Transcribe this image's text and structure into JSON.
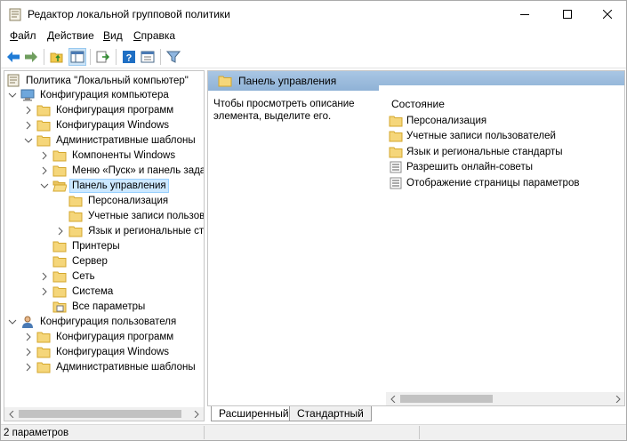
{
  "window": {
    "title": "Редактор локальной групповой политики"
  },
  "menu": [
    {
      "pre": "",
      "key": "Ф",
      "post": "айл"
    },
    {
      "pre": "",
      "key": "Д",
      "post": "ействие"
    },
    {
      "pre": "",
      "key": "В",
      "post": "ид"
    },
    {
      "pre": "",
      "key": "С",
      "post": "правка"
    }
  ],
  "tree": [
    {
      "label": "Политика \"Локальный компьютер\"",
      "icon": "policy-icon",
      "chev": "none",
      "indent": 0
    },
    {
      "label": "Конфигурация компьютера",
      "icon": "computer-icon",
      "chev": "down",
      "indent": 1
    },
    {
      "label": "Конфигурация программ",
      "icon": "folder-icon",
      "chev": "right",
      "indent": 2
    },
    {
      "label": "Конфигурация Windows",
      "icon": "folder-icon",
      "chev": "right",
      "indent": 2
    },
    {
      "label": "Административные шаблоны",
      "icon": "folder-icon",
      "chev": "down",
      "indent": 2
    },
    {
      "label": "Компоненты Windows",
      "icon": "folder-icon",
      "chev": "right",
      "indent": 3
    },
    {
      "label": "Меню «Пуск» и панель задач",
      "icon": "folder-icon",
      "chev": "right",
      "indent": 3
    },
    {
      "label": "Панель управления",
      "icon": "folder-open-icon",
      "chev": "down",
      "indent": 3,
      "selected": true
    },
    {
      "label": "Персонализация",
      "icon": "folder-icon",
      "chev": "none",
      "indent": 4
    },
    {
      "label": "Учетные записи пользователей",
      "icon": "folder-icon",
      "chev": "none",
      "indent": 4
    },
    {
      "label": "Язык и региональные стандарты",
      "icon": "folder-icon",
      "chev": "right",
      "indent": 4
    },
    {
      "label": "Принтеры",
      "icon": "folder-icon",
      "chev": "none",
      "indent": 3
    },
    {
      "label": "Сервер",
      "icon": "folder-icon",
      "chev": "none",
      "indent": 3
    },
    {
      "label": "Сеть",
      "icon": "folder-icon",
      "chev": "right",
      "indent": 3
    },
    {
      "label": "Система",
      "icon": "folder-icon",
      "chev": "right",
      "indent": 3
    },
    {
      "label": "Все параметры",
      "icon": "settings-folder-icon",
      "chev": "none",
      "indent": 3
    },
    {
      "label": "Конфигурация пользователя",
      "icon": "user-icon",
      "chev": "down",
      "indent": 1
    },
    {
      "label": "Конфигурация программ",
      "icon": "folder-icon",
      "chev": "right",
      "indent": 2
    },
    {
      "label": "Конфигурация Windows",
      "icon": "folder-icon",
      "chev": "right",
      "indent": 2
    },
    {
      "label": "Административные шаблоны",
      "icon": "folder-icon",
      "chev": "right",
      "indent": 2
    }
  ],
  "right": {
    "header": "Панель управления",
    "description": "Чтобы просмотреть описание элемента, выделите его.",
    "column": "Состояние",
    "items": [
      {
        "label": "Персонализация",
        "icon": "folder-icon"
      },
      {
        "label": "Учетные записи пользователей",
        "icon": "folder-icon"
      },
      {
        "label": "Язык и региональные стандарты",
        "icon": "folder-icon"
      },
      {
        "label": "Разрешить онлайн-советы",
        "icon": "setting-icon"
      },
      {
        "label": "Отображение страницы параметров",
        "icon": "setting-icon"
      }
    ]
  },
  "tabs": {
    "extended": "Расширенный",
    "standard": "Стандартный"
  },
  "status": {
    "text": "2 параметров"
  }
}
